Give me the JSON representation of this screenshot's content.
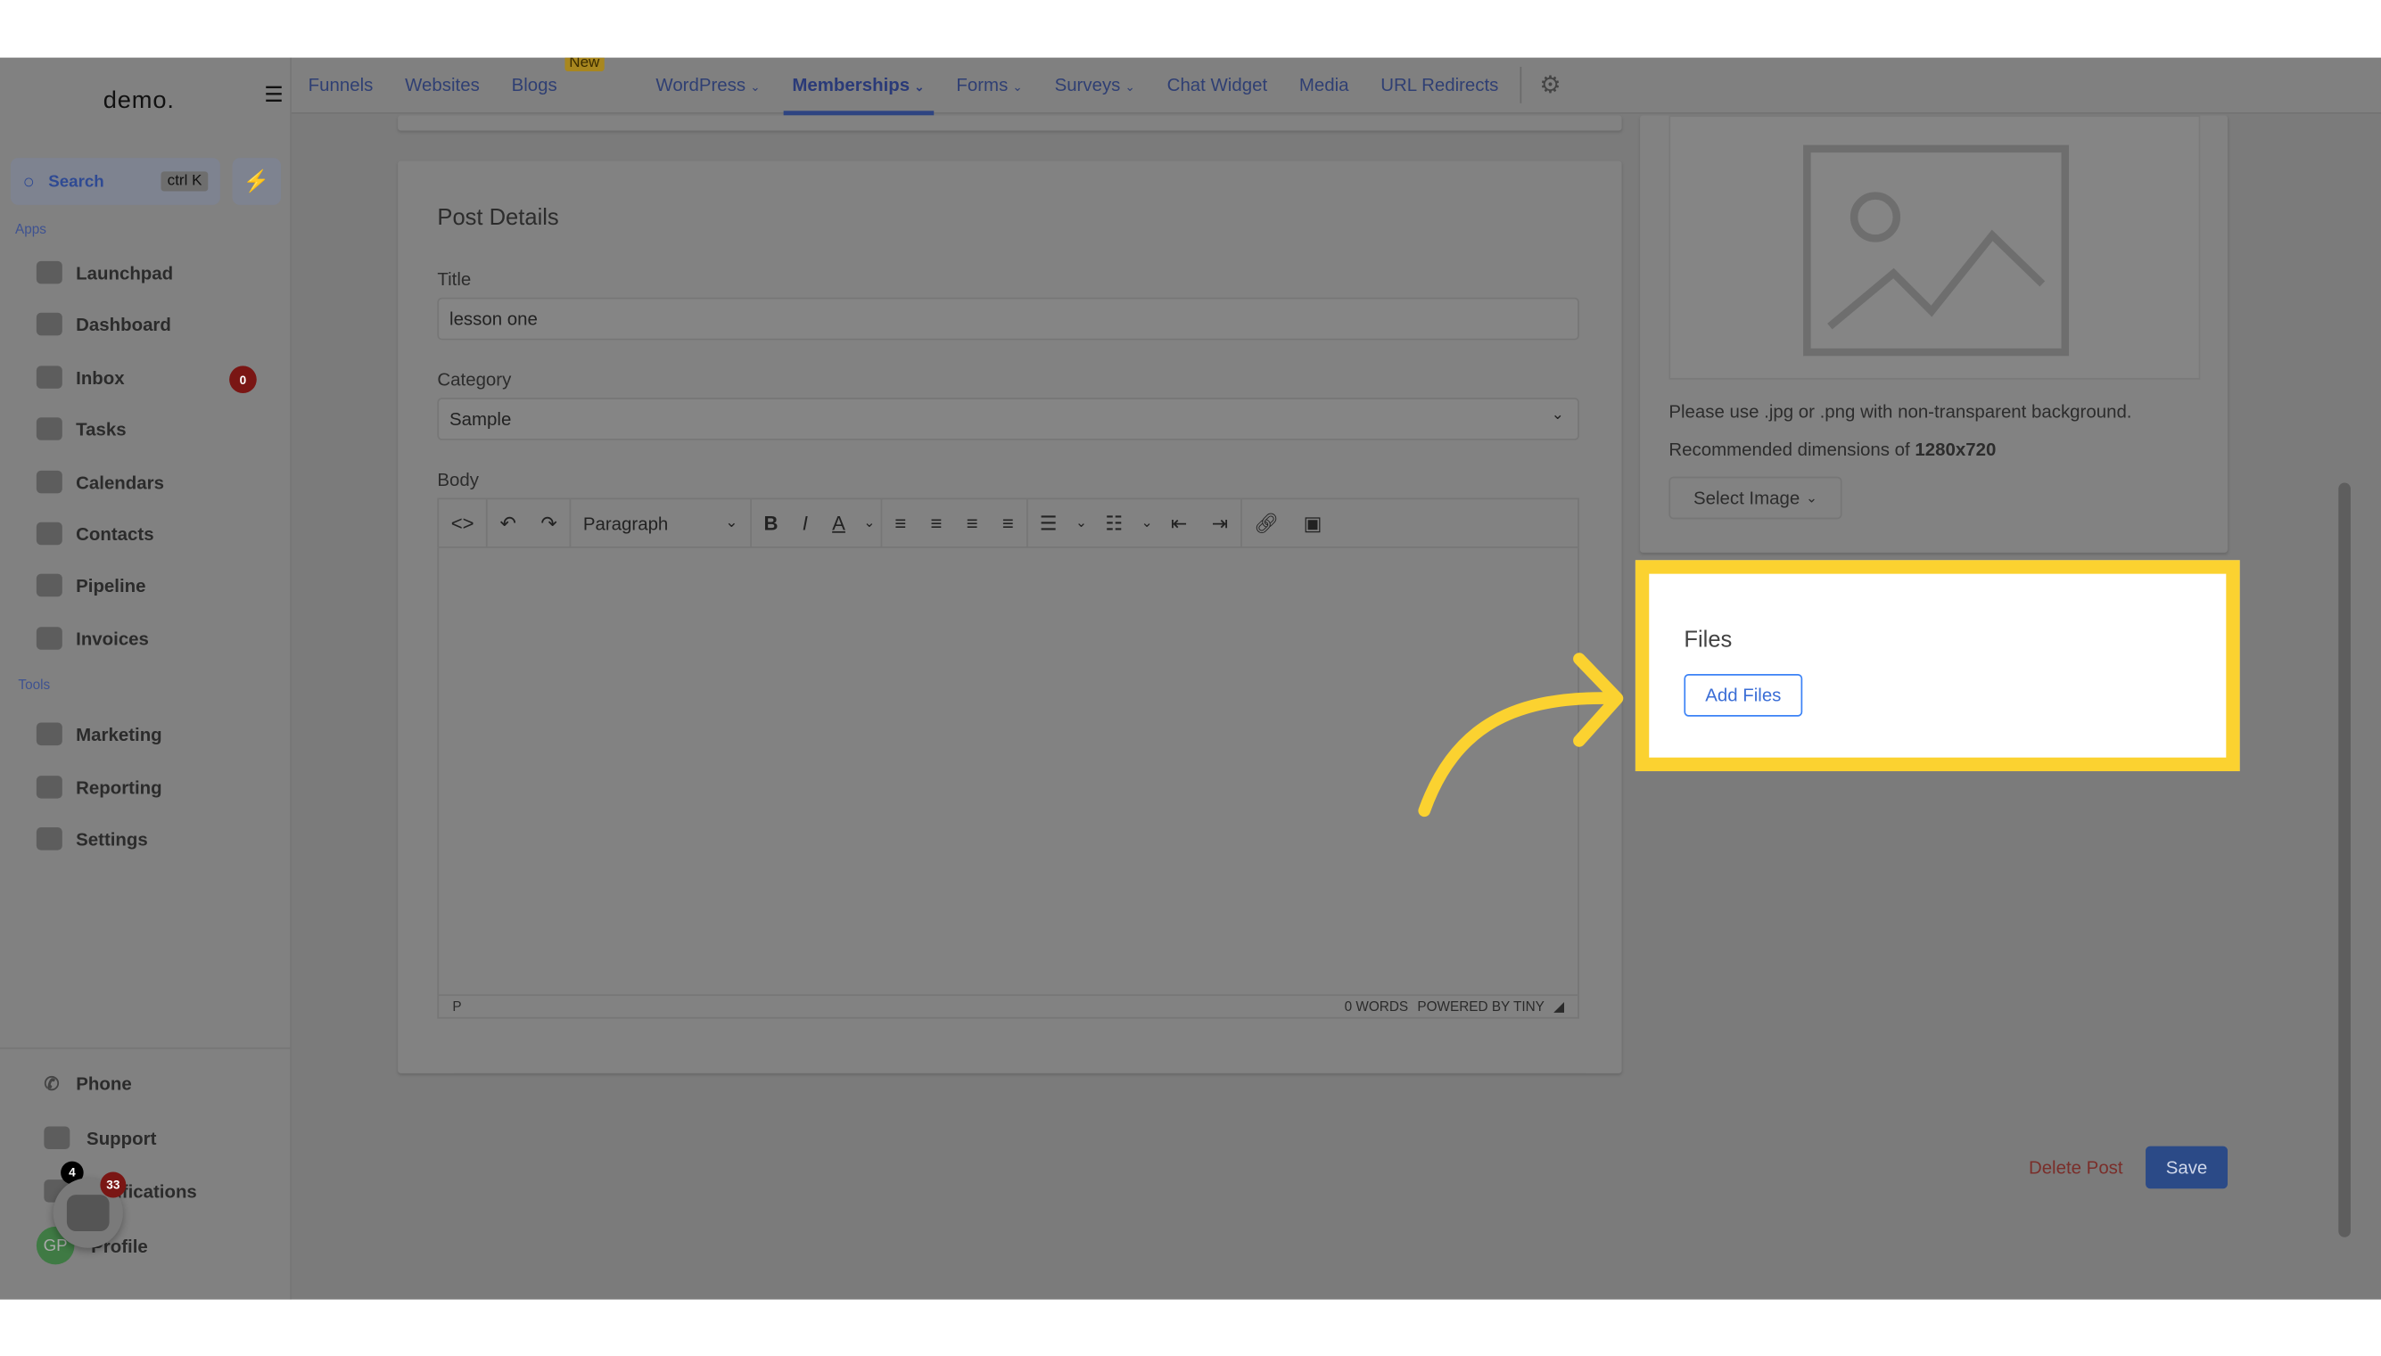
{
  "sidebar": {
    "logo": "demo.",
    "search_label": "Search",
    "search_shortcut": "ctrl K",
    "apps_heading": "Apps",
    "tools_heading": "Tools",
    "apps": [
      {
        "label": "Launchpad",
        "icon": "rocket-icon"
      },
      {
        "label": "Dashboard",
        "icon": "grid-icon"
      },
      {
        "label": "Inbox",
        "icon": "inbox-icon",
        "badge": "0"
      },
      {
        "label": "Tasks",
        "icon": "tasks-icon"
      },
      {
        "label": "Calendars",
        "icon": "calendar-icon"
      },
      {
        "label": "Contacts",
        "icon": "person-icon"
      },
      {
        "label": "Pipeline",
        "icon": "funnel-icon"
      },
      {
        "label": "Invoices",
        "icon": "invoice-icon"
      }
    ],
    "tools": [
      {
        "label": "Marketing",
        "icon": "megaphone-icon"
      },
      {
        "label": "Reporting",
        "icon": "chart-icon"
      },
      {
        "label": "Settings",
        "icon": "gear-icon"
      }
    ],
    "bottom": [
      {
        "label": "Phone",
        "icon": "phone-icon"
      },
      {
        "label": "Support",
        "icon": "chat-icon"
      },
      {
        "label": "Notifications",
        "icon": "bell-icon",
        "badge": "4"
      },
      {
        "label": "Profile",
        "avatar": "GP"
      }
    ],
    "chat_widget_badge": "33"
  },
  "topnav": {
    "items": [
      "Funnels",
      "Websites",
      "Blogs",
      "WordPress",
      "Memberships",
      "Forms",
      "Surveys",
      "Chat Widget",
      "Media",
      "URL Redirects"
    ],
    "new_badge": "New",
    "active": "Memberships"
  },
  "post": {
    "heading": "Post Details",
    "title_label": "Title",
    "title_value": "lesson one",
    "category_label": "Category",
    "category_value": "Sample",
    "body_label": "Body",
    "format_value": "Paragraph",
    "status_path": "P",
    "word_count": "0 WORDS",
    "powered_by": "POWERED BY TINY"
  },
  "image": {
    "hint": "Please use .jpg or .png with non-transparent background.",
    "dims_prefix": "Recommended dimensions of ",
    "dims_value": "1280x720",
    "select_label": "Select Image"
  },
  "files": {
    "heading": "Files",
    "add_label": "Add Files"
  },
  "actions": {
    "delete_label": "Delete Post",
    "save_label": "Save"
  },
  "colors": {
    "highlight": "#fbd230",
    "accent": "#3b82f6",
    "danger": "#7a2e2a"
  }
}
